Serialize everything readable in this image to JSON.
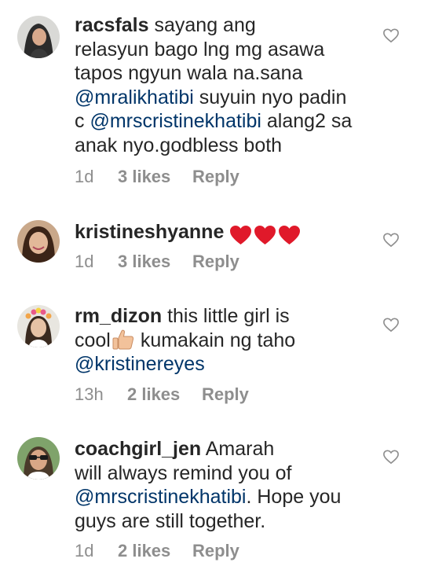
{
  "comments": [
    {
      "username": "racsfals",
      "parts": [
        {
          "t": "sayang ang\nrelasyun bago lng mg asawa\ntapos ngyun wala na.sana\n"
        },
        {
          "t": "@mralikhatibi",
          "m": true
        },
        {
          "t": "  suyuin nyo padin\nc "
        },
        {
          "t": "@mrscristinekhatibi",
          "m": true
        },
        {
          "t": " alang2 sa\nanak nyo.godbless both"
        }
      ],
      "time": "1d",
      "likes": "3 likes",
      "reply": "Reply",
      "avatar_icon": "woman-avatar-icon"
    },
    {
      "username": "kristineshyanne",
      "parts": [],
      "emoji": [
        "red-heart-icon",
        "red-heart-icon",
        "red-heart-icon"
      ],
      "time": "1d",
      "likes": "3 likes",
      "reply": "Reply",
      "avatar_icon": "woman-avatar-icon"
    },
    {
      "username": "rm_dizon",
      "parts": [
        {
          "t": "this little girl is\ncool"
        },
        {
          "emoji": "thumbs-up-icon"
        },
        {
          "t": " kumakain ng taho\n"
        },
        {
          "t": "@kristinereyes",
          "m": true
        }
      ],
      "time": "13h",
      "likes": "2 likes",
      "reply": "Reply",
      "avatar_icon": "girl-flower-crown-avatar-icon"
    },
    {
      "username": "coachgirl_jen",
      "parts": [
        {
          "t": "Amarah\nwill always remind you of\n"
        },
        {
          "t": "@mrscristinekhatibi",
          "m": true
        },
        {
          "t": ". Hope you\nguys are still together."
        }
      ],
      "time": "1d",
      "likes": "2 likes",
      "reply": "Reply",
      "avatar_icon": "woman-sunglasses-avatar-icon"
    }
  ],
  "colors": {
    "text": "#262626",
    "mention": "#003569",
    "meta": "#8e8e8e",
    "heart": "#e0192a"
  }
}
